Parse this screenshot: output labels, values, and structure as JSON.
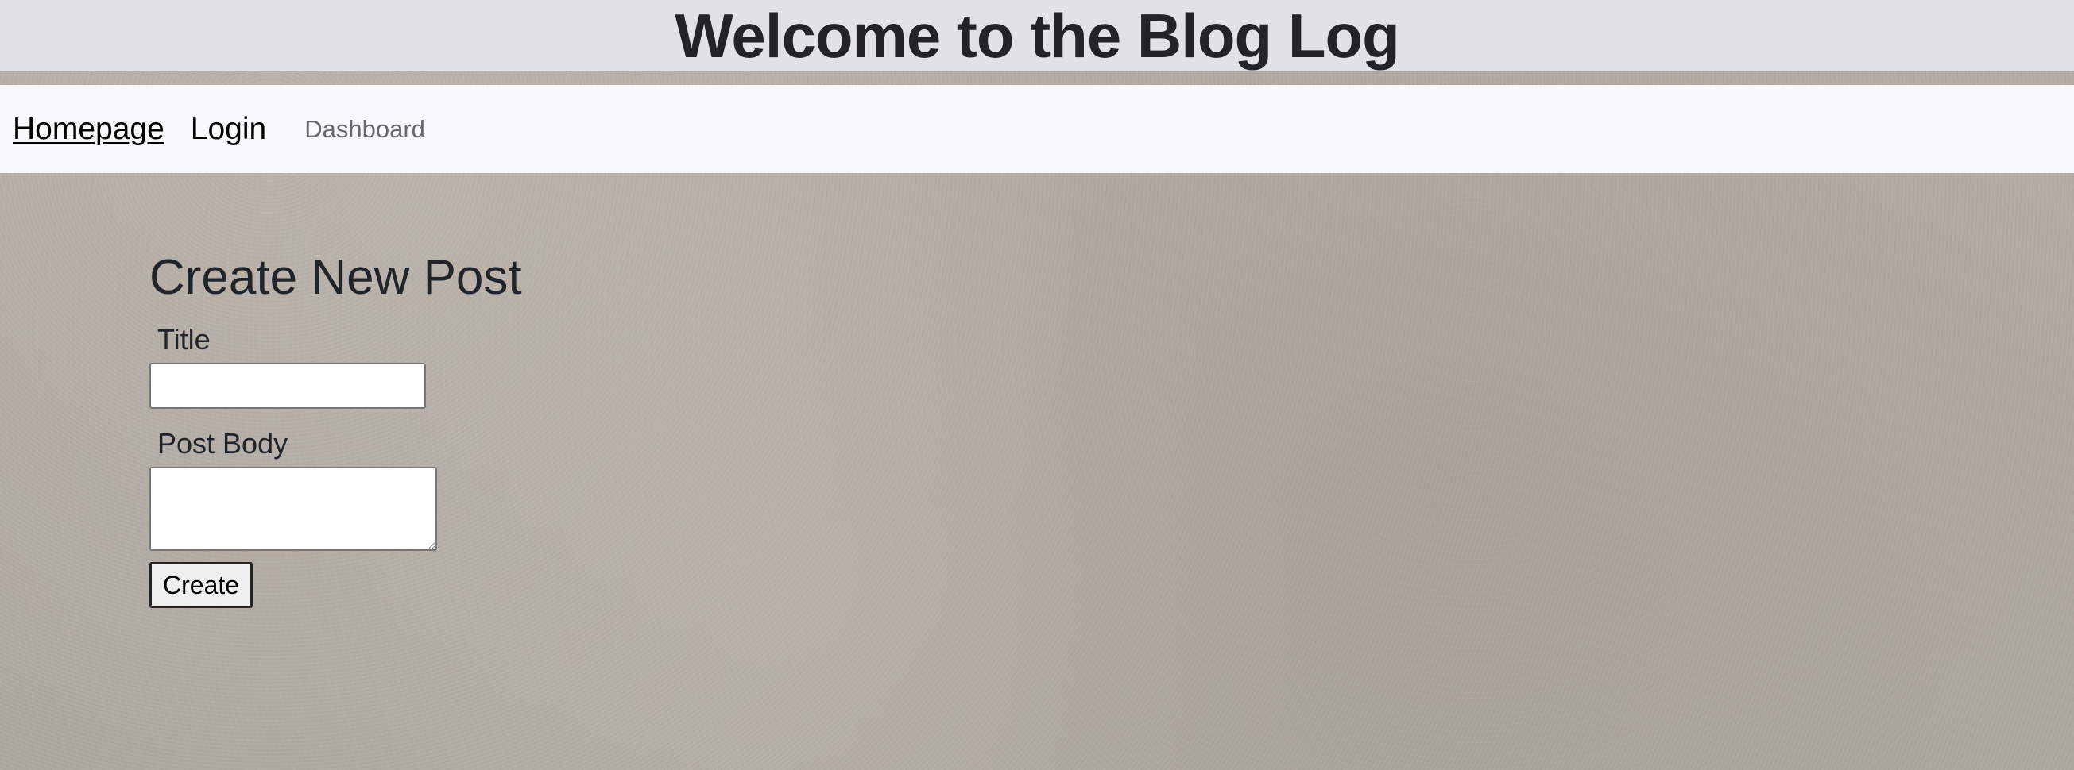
{
  "header": {
    "title": "Welcome to the Blog Log"
  },
  "nav": {
    "items": [
      {
        "label": "Homepage"
      },
      {
        "label": "Login"
      },
      {
        "label": "Dashboard"
      }
    ]
  },
  "form": {
    "heading": "Create New Post",
    "title_label": "Title",
    "title_value": "",
    "body_label": "Post Body",
    "body_value": "",
    "submit_label": "Create"
  },
  "colors": {
    "header_bg": "#dfe3e6",
    "nav_bg": "#f8f9fa",
    "text": "#212529",
    "muted_link": "#666a6e"
  }
}
